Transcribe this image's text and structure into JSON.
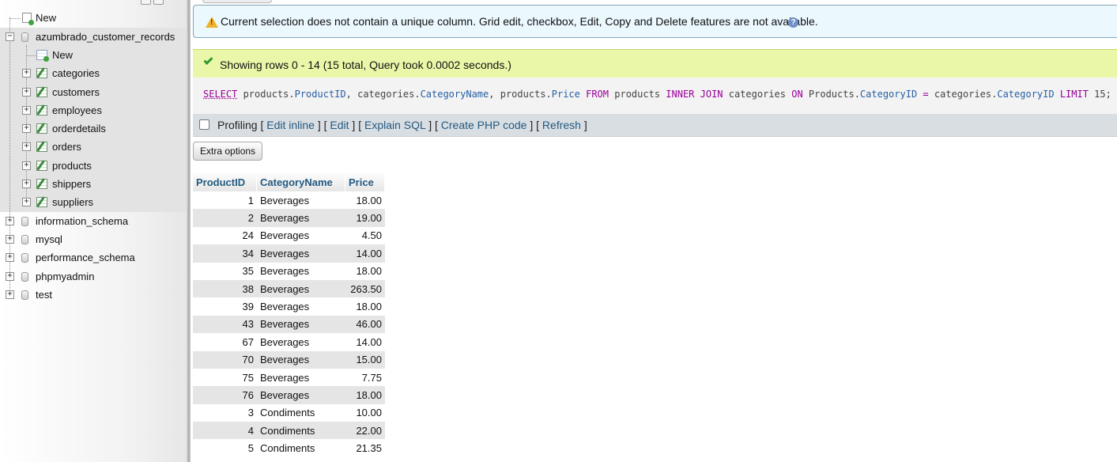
{
  "nav": {
    "new_label": "New",
    "database": {
      "name": "azumbrado_customer_records",
      "new_label": "New",
      "tables": [
        "categories",
        "customers",
        "employees",
        "orderdetails",
        "orders",
        "products",
        "shippers",
        "suppliers"
      ]
    },
    "other_databases": [
      "information_schema",
      "mysql",
      "performance_schema",
      "phpmyadmin",
      "test"
    ]
  },
  "notice": {
    "text": "Current selection does not contain a unique column. Grid edit, checkbox, Edit, Copy and Delete features are not available.",
    "icon": "warning-icon",
    "help_icon": "?"
  },
  "success": {
    "text": "Showing rows 0 - 14 (15 total, Query took 0.0002 seconds.)",
    "icon": "check-icon"
  },
  "sql": {
    "tokens": [
      {
        "t": "SELECT",
        "c": "kw-select"
      },
      {
        "t": " products.",
        "c": ""
      },
      {
        "t": "ProductID",
        "c": "ident"
      },
      {
        "t": ", categories.",
        "c": ""
      },
      {
        "t": "CategoryName",
        "c": "ident"
      },
      {
        "t": ", products.",
        "c": ""
      },
      {
        "t": "Price",
        "c": "ident"
      },
      {
        "t": " ",
        "c": ""
      },
      {
        "t": "FROM",
        "c": "kw"
      },
      {
        "t": " products ",
        "c": ""
      },
      {
        "t": "INNER JOIN",
        "c": "kw"
      },
      {
        "t": " categories ",
        "c": ""
      },
      {
        "t": "ON",
        "c": "kw"
      },
      {
        "t": " Products.",
        "c": ""
      },
      {
        "t": "CategoryID",
        "c": "ident"
      },
      {
        "t": " ",
        "c": ""
      },
      {
        "t": "=",
        "c": "op"
      },
      {
        "t": " categories.",
        "c": ""
      },
      {
        "t": "CategoryID",
        "c": "ident"
      },
      {
        "t": " ",
        "c": ""
      },
      {
        "t": "LIMIT",
        "c": "kw"
      },
      {
        "t": " 15;",
        "c": ""
      }
    ]
  },
  "links_bar": {
    "profiling_label": "Profiling",
    "edit_inline": "Edit inline",
    "edit": "Edit",
    "explain_sql": "Explain SQL",
    "create_php_code": "Create PHP code",
    "refresh": "Refresh"
  },
  "extra_options_label": "Extra options",
  "results": {
    "columns": [
      "ProductID",
      "CategoryName",
      "Price"
    ],
    "rows": [
      [
        "1",
        "Beverages",
        "18.00"
      ],
      [
        "2",
        "Beverages",
        "19.00"
      ],
      [
        "24",
        "Beverages",
        "4.50"
      ],
      [
        "34",
        "Beverages",
        "14.00"
      ],
      [
        "35",
        "Beverages",
        "18.00"
      ],
      [
        "38",
        "Beverages",
        "263.50"
      ],
      [
        "39",
        "Beverages",
        "18.00"
      ],
      [
        "43",
        "Beverages",
        "46.00"
      ],
      [
        "67",
        "Beverages",
        "14.00"
      ],
      [
        "70",
        "Beverages",
        "15.00"
      ],
      [
        "75",
        "Beverages",
        "7.75"
      ],
      [
        "76",
        "Beverages",
        "18.00"
      ],
      [
        "3",
        "Condiments",
        "10.00"
      ],
      [
        "4",
        "Condiments",
        "22.00"
      ],
      [
        "5",
        "Condiments",
        "21.35"
      ]
    ]
  },
  "colors": {
    "link": "#235a81",
    "notice_bg": "#ebf8fd",
    "success_bg": "#ebf7a8",
    "sql_keyword": "#990099",
    "sql_identifier": "#2660a4"
  }
}
